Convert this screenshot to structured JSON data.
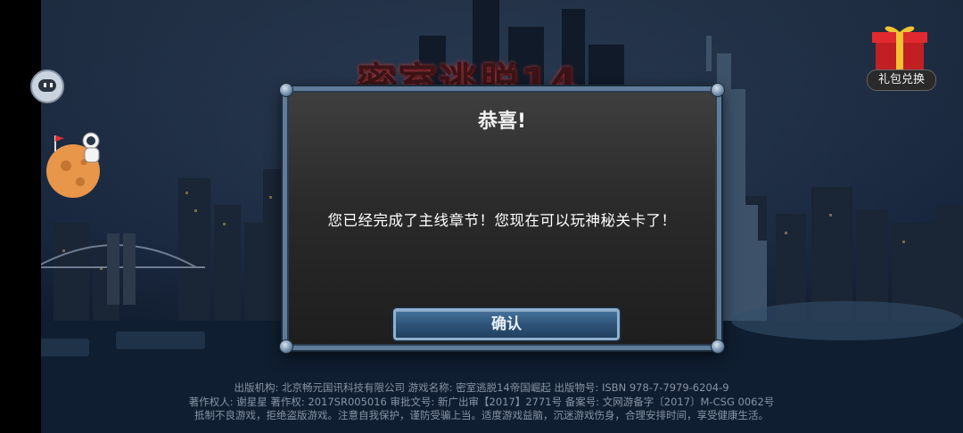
{
  "game": {
    "title": "密室逃脱14"
  },
  "gift": {
    "label": "礼包兑换",
    "icon": "gift-box-icon"
  },
  "dialog": {
    "title": "恭喜!",
    "message": "您已经完成了主线章节！您现在可以玩神秘关卡了！",
    "confirm_label": "确认"
  },
  "footer": {
    "line1": "出版机构: 北京畅元国讯科技有限公司    游戏名称: 密室逃脱14帝国崛起    出版物号: ISBN 978-7-7979-6204-9",
    "line2": "著作权人: 谢星星    著作权: 2017SR005016    审批文号: 新广出审【2017】2771号    备案号: 文网游备字〔2017〕M-CSG 0062号",
    "line3": "抵制不良游戏，拒绝盗版游戏。注意自我保护，谨防受骗上当。适度游戏益脑，沉迷游戏伤身，合理安排时间，享受健康生活。"
  },
  "colors": {
    "dialog_border": "#5f7d9a",
    "button_fill": "#2f5479",
    "sky": "#0b1626"
  }
}
